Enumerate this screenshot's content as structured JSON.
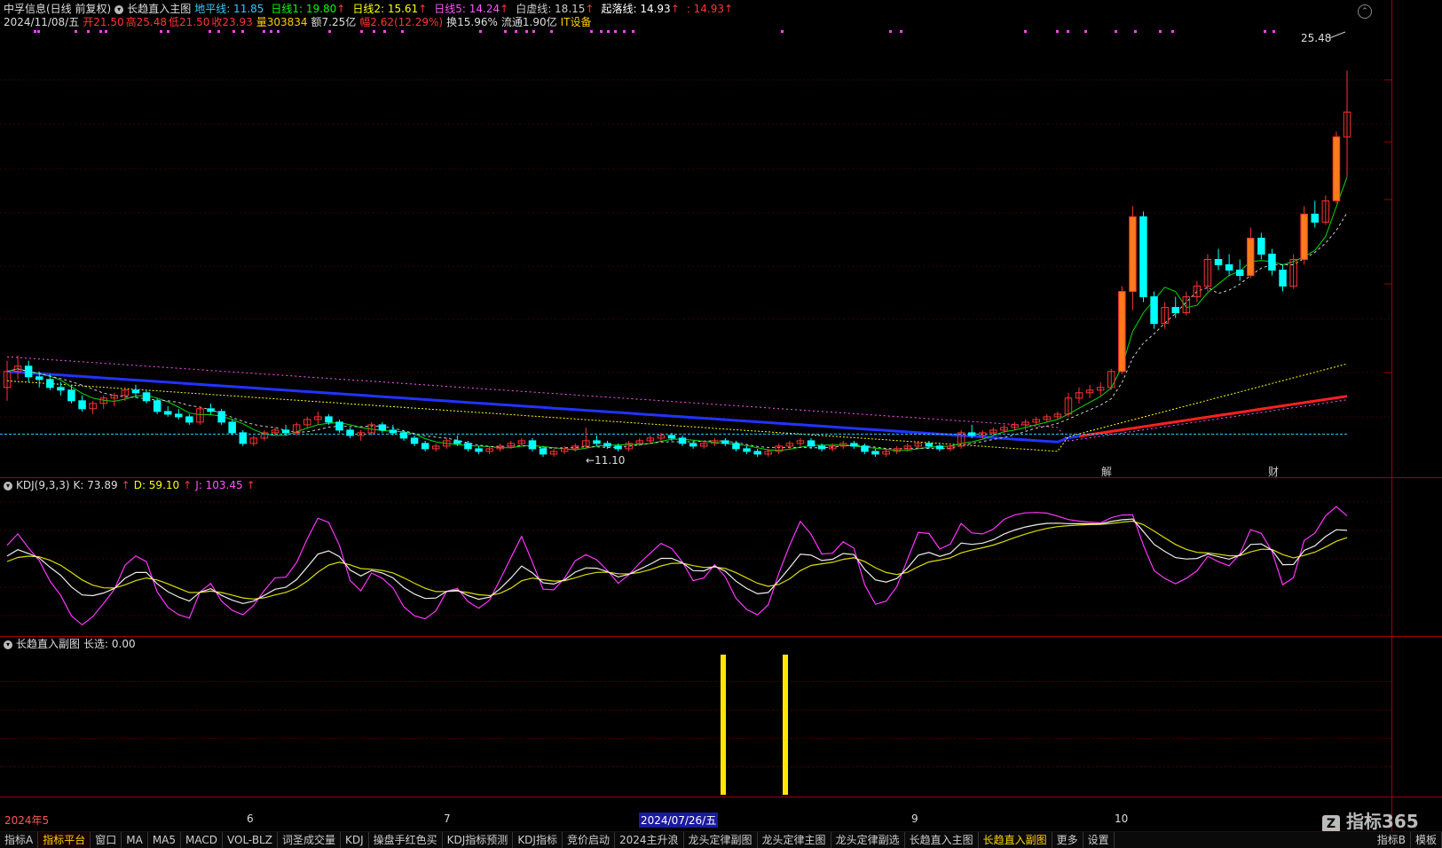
{
  "header": {
    "stock": "中孚信息(日线 前复权)",
    "indicator_main": "长趋直入主图",
    "ma_lines": [
      {
        "label": "地平线: 11.85",
        "color": "#33ccff",
        "arrow": ""
      },
      {
        "label": "日线1: 19.80",
        "color": "#00ff00",
        "arrow": "↑"
      },
      {
        "label": "日线2: 15.61",
        "color": "#ffff00",
        "arrow": "↑"
      },
      {
        "label": "日线5: 14.24",
        "color": "#ff55ff",
        "arrow": "↑"
      },
      {
        "label": "白虚线: 18.15",
        "color": "#cccccc",
        "arrow": "↑"
      },
      {
        "label": "起落线: 14.93",
        "color": "#ffffff",
        "arrow": "↑"
      },
      {
        "label": ": 14.93",
        "color": "#ff3333",
        "arrow": "↑"
      }
    ]
  },
  "info_row": {
    "date": "2024/11/08/五",
    "items": [
      {
        "label": "开",
        "value": "21.50"
      },
      {
        "label": "高",
        "value": "25.48"
      },
      {
        "label": "低",
        "value": "21.50"
      },
      {
        "label": "收",
        "value": "23.93"
      }
    ],
    "volume": "量303834",
    "amount": "额7.25亿",
    "change": "幅2.62(12.29%)",
    "turnover": "换15.96%",
    "float": "流通1.90亿",
    "sector": "IT设备"
  },
  "chart_data": {
    "type": "candlestick",
    "high_label": "25.48",
    "low_label": "11.10",
    "price_range": [
      10.3,
      26.8
    ],
    "candles": [
      [
        13.6,
        14.6,
        13.1,
        14.2
      ],
      [
        14.2,
        14.8,
        13.9,
        14.4
      ],
      [
        14.4,
        14.6,
        13.8,
        14.0
      ],
      [
        14.0,
        14.2,
        13.6,
        13.9
      ],
      [
        13.9,
        14.1,
        13.5,
        13.6
      ],
      [
        13.6,
        13.8,
        13.3,
        13.5
      ],
      [
        13.5,
        13.7,
        13.0,
        13.1
      ],
      [
        13.1,
        13.3,
        12.7,
        12.8
      ],
      [
        12.8,
        13.1,
        12.6,
        13.0
      ],
      [
        13.0,
        13.3,
        12.8,
        13.2
      ],
      [
        13.2,
        13.4,
        12.9,
        13.3
      ],
      [
        13.3,
        13.6,
        13.1,
        13.5
      ],
      [
        13.5,
        13.7,
        13.2,
        13.4
      ],
      [
        13.4,
        13.5,
        13.0,
        13.1
      ],
      [
        13.1,
        13.2,
        12.6,
        12.7
      ],
      [
        12.7,
        12.9,
        12.5,
        12.6
      ],
      [
        12.6,
        12.8,
        12.4,
        12.5
      ],
      [
        12.5,
        12.6,
        12.2,
        12.3
      ],
      [
        12.3,
        12.9,
        12.2,
        12.8
      ],
      [
        12.8,
        13.0,
        12.6,
        12.7
      ],
      [
        12.7,
        12.8,
        12.2,
        12.3
      ],
      [
        12.3,
        12.4,
        11.8,
        11.9
      ],
      [
        11.9,
        12.0,
        11.4,
        11.5
      ],
      [
        11.5,
        11.8,
        11.4,
        11.7
      ],
      [
        11.7,
        12.0,
        11.6,
        11.9
      ],
      [
        11.9,
        12.1,
        11.8,
        12.0
      ],
      [
        12.0,
        12.2,
        11.8,
        11.9
      ],
      [
        11.9,
        12.3,
        11.8,
        12.2
      ],
      [
        12.2,
        12.5,
        12.1,
        12.4
      ],
      [
        12.4,
        12.7,
        12.2,
        12.5
      ],
      [
        12.5,
        12.6,
        12.2,
        12.3
      ],
      [
        12.3,
        12.4,
        11.9,
        12.0
      ],
      [
        12.0,
        12.1,
        11.7,
        11.8
      ],
      [
        11.8,
        12.0,
        11.6,
        11.9
      ],
      [
        11.9,
        12.3,
        11.8,
        12.2
      ],
      [
        12.2,
        12.3,
        11.9,
        12.0
      ],
      [
        12.0,
        12.2,
        11.8,
        11.9
      ],
      [
        11.9,
        12.0,
        11.6,
        11.7
      ],
      [
        11.7,
        11.8,
        11.4,
        11.5
      ],
      [
        11.5,
        11.6,
        11.2,
        11.3
      ],
      [
        11.3,
        11.5,
        11.2,
        11.4
      ],
      [
        11.4,
        11.7,
        11.3,
        11.6
      ],
      [
        11.6,
        11.8,
        11.4,
        11.5
      ],
      [
        11.5,
        11.6,
        11.2,
        11.3
      ],
      [
        11.3,
        11.4,
        11.1,
        11.2
      ],
      [
        11.2,
        11.4,
        11.1,
        11.3
      ],
      [
        11.3,
        11.5,
        11.2,
        11.4
      ],
      [
        11.4,
        11.6,
        11.3,
        11.5
      ],
      [
        11.5,
        11.7,
        11.4,
        11.6
      ],
      [
        11.6,
        11.7,
        11.2,
        11.3
      ],
      [
        11.3,
        11.4,
        11.0,
        11.1
      ],
      [
        11.1,
        11.3,
        11.0,
        11.2
      ],
      [
        11.2,
        11.4,
        11.1,
        11.3
      ],
      [
        11.3,
        11.5,
        11.2,
        11.4
      ],
      [
        11.4,
        12.1,
        11.3,
        11.6
      ],
      [
        11.6,
        11.8,
        11.4,
        11.5
      ],
      [
        11.5,
        11.6,
        11.3,
        11.4
      ],
      [
        11.4,
        11.5,
        11.2,
        11.3
      ],
      [
        11.3,
        11.6,
        11.2,
        11.5
      ],
      [
        11.5,
        11.7,
        11.4,
        11.6
      ],
      [
        11.6,
        11.8,
        11.5,
        11.7
      ],
      [
        11.7,
        11.9,
        11.6,
        11.8
      ],
      [
        11.8,
        11.9,
        11.6,
        11.7
      ],
      [
        11.7,
        11.8,
        11.4,
        11.5
      ],
      [
        11.5,
        11.6,
        11.3,
        11.4
      ],
      [
        11.4,
        11.6,
        11.3,
        11.5
      ],
      [
        11.5,
        11.7,
        11.4,
        11.6
      ],
      [
        11.6,
        11.7,
        11.4,
        11.5
      ],
      [
        11.5,
        11.6,
        11.2,
        11.3
      ],
      [
        11.3,
        11.4,
        11.1,
        11.2
      ],
      [
        11.2,
        11.3,
        11.0,
        11.1
      ],
      [
        11.1,
        11.3,
        11.0,
        11.2
      ],
      [
        11.2,
        11.5,
        11.1,
        11.4
      ],
      [
        11.4,
        11.6,
        11.3,
        11.5
      ],
      [
        11.5,
        11.7,
        11.4,
        11.6
      ],
      [
        11.6,
        11.7,
        11.3,
        11.4
      ],
      [
        11.4,
        11.5,
        11.2,
        11.3
      ],
      [
        11.3,
        11.5,
        11.2,
        11.4
      ],
      [
        11.4,
        11.6,
        11.3,
        11.5
      ],
      [
        11.5,
        11.6,
        11.3,
        11.4
      ],
      [
        11.4,
        11.5,
        11.1,
        11.2
      ],
      [
        11.2,
        11.3,
        11.0,
        11.1
      ],
      [
        11.1,
        11.3,
        11.0,
        11.2
      ],
      [
        11.2,
        11.4,
        11.1,
        11.3
      ],
      [
        11.3,
        11.5,
        11.2,
        11.4
      ],
      [
        11.4,
        11.6,
        11.3,
        11.5
      ],
      [
        11.5,
        11.6,
        11.3,
        11.4
      ],
      [
        11.4,
        11.5,
        11.2,
        11.3
      ],
      [
        11.3,
        11.5,
        11.2,
        11.4
      ],
      [
        11.4,
        12.0,
        11.3,
        11.9
      ],
      [
        11.9,
        12.2,
        11.7,
        11.8
      ],
      [
        11.8,
        12.0,
        11.7,
        11.9
      ],
      [
        11.9,
        12.1,
        11.8,
        12.0
      ],
      [
        12.0,
        12.2,
        11.9,
        12.1
      ],
      [
        12.1,
        12.3,
        12.0,
        12.2
      ],
      [
        12.2,
        12.4,
        12.0,
        12.3
      ],
      [
        12.3,
        12.5,
        12.2,
        12.4
      ],
      [
        12.4,
        12.6,
        12.3,
        12.5
      ],
      [
        12.5,
        12.7,
        12.4,
        12.6
      ],
      [
        12.6,
        13.4,
        12.5,
        13.2
      ],
      [
        13.2,
        13.6,
        13.0,
        13.4
      ],
      [
        13.4,
        13.7,
        13.2,
        13.5
      ],
      [
        13.5,
        13.8,
        13.3,
        13.6
      ],
      [
        13.6,
        14.3,
        13.5,
        14.2
      ],
      [
        14.2,
        17.4,
        14.1,
        17.2
      ],
      [
        17.2,
        20.4,
        16.5,
        20.0
      ],
      [
        20.0,
        20.2,
        16.8,
        17.0
      ],
      [
        17.0,
        17.2,
        15.8,
        16.0
      ],
      [
        16.0,
        16.8,
        15.8,
        16.6
      ],
      [
        16.6,
        17.0,
        16.2,
        16.4
      ],
      [
        16.4,
        17.2,
        16.3,
        17.0
      ],
      [
        17.0,
        17.6,
        16.8,
        17.4
      ],
      [
        17.4,
        18.6,
        17.2,
        18.4
      ],
      [
        18.4,
        18.8,
        18.0,
        18.2
      ],
      [
        18.2,
        18.6,
        17.8,
        18.0
      ],
      [
        18.0,
        18.4,
        17.6,
        17.8
      ],
      [
        17.8,
        19.6,
        17.7,
        19.2
      ],
      [
        19.2,
        19.4,
        18.4,
        18.6
      ],
      [
        18.6,
        18.8,
        17.8,
        18.0
      ],
      [
        18.0,
        18.2,
        17.2,
        17.4
      ],
      [
        17.4,
        18.6,
        17.3,
        18.4
      ],
      [
        18.4,
        20.4,
        18.2,
        20.1
      ],
      [
        20.1,
        20.6,
        19.6,
        19.8
      ],
      [
        19.8,
        20.8,
        19.7,
        20.6
      ],
      [
        20.6,
        23.2,
        20.5,
        23.0
      ],
      [
        23.0,
        25.48,
        21.5,
        23.93
      ]
    ],
    "ma_fast": "green",
    "ma_trend": "blue-to-red",
    "kdj": {
      "label": "KDJ(9,3,3)",
      "k": "K: 73.89",
      "d": "D: 59.10",
      "j": "J: 103.45"
    },
    "sub": {
      "label": "长趋直入副图",
      "value": "长选: 0.00"
    },
    "x_labels": [
      "2024年5",
      "6",
      "7",
      "2024/07/26/五",
      "9",
      "10"
    ],
    "markers": [
      "解",
      "财"
    ]
  },
  "tabs": [
    "指标A",
    "指标平台",
    "窗口",
    "MA",
    "MA5",
    "MACD",
    "VOL-BLZ",
    "词圣成交量",
    "KDJ",
    "操盘手红色买",
    "KDJ指标预测",
    "KDJ指标",
    "竞价启动",
    "2024主升浪",
    "龙头定律副图",
    "龙头定律主图",
    "龙头定律副选",
    "长趋直入主图",
    "长趋直入副图",
    "更多",
    "设置"
  ],
  "right_tabs": [
    "指标B",
    "模板"
  ],
  "watermark": "指标365",
  "colors": {
    "up": "#ff3333",
    "down": "#00ffff",
    "border": "#a00000"
  }
}
